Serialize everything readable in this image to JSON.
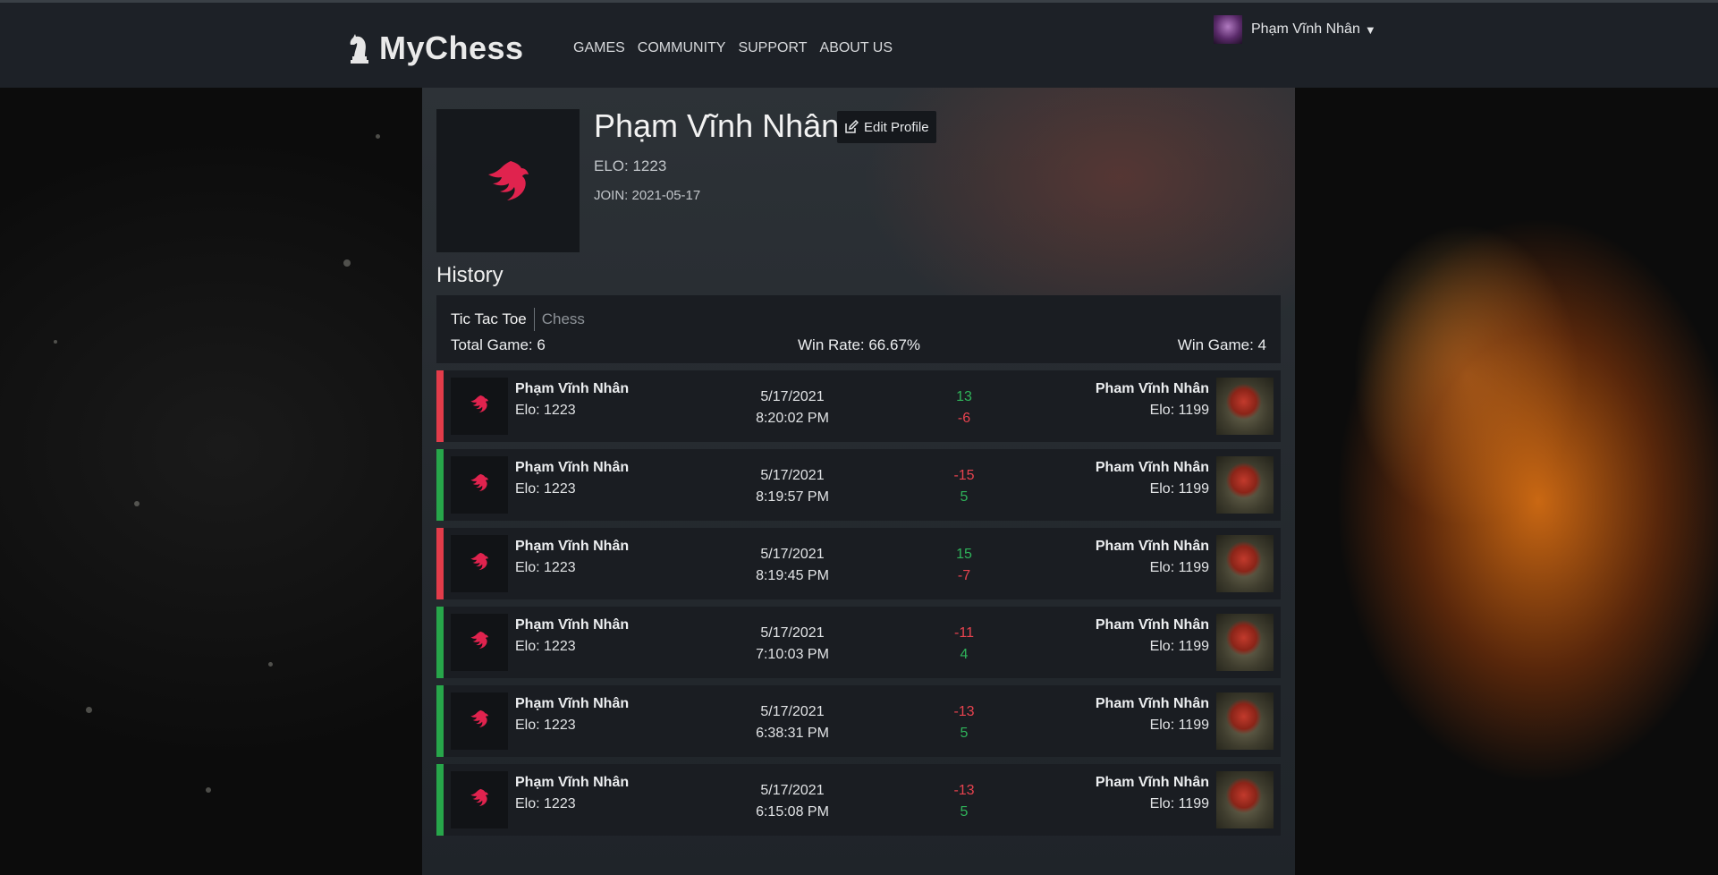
{
  "nav": {
    "brand": "MyChess",
    "links": [
      "GAMES",
      "COMMUNITY",
      "SUPPORT",
      "ABOUT US"
    ],
    "user_name": "Phạm Vĩnh Nhân"
  },
  "profile": {
    "name": "Phạm Vĩnh Nhân",
    "edit_label": "Edit Profile",
    "elo": "ELO: 1223",
    "join": "JOIN: 2021-05-17"
  },
  "history": {
    "title": "History",
    "tabs": [
      "Tic Tac Toe",
      "Chess"
    ],
    "active_tab": "Tic Tac Toe",
    "total": "Total Game: 6",
    "win_rate": "Win Rate: 66.67%",
    "win_game": "Win Game: 4"
  },
  "colors": {
    "loss_bar": "#e23c4a",
    "win_bar": "#27a64a",
    "positive": "#2fb45a",
    "negative": "#e8434f",
    "accent_logo": "#e0234e"
  },
  "games": [
    {
      "result": "loss",
      "p1_name": "Phạm Vĩnh Nhân",
      "p1_elo": "Elo: 1223",
      "date": "5/17/2021",
      "time": "8:20:02 PM",
      "delta_top": "13",
      "delta_bottom": "-6",
      "p2_name": "Pham Vĩnh Nhân",
      "p2_elo": "Elo: 1199"
    },
    {
      "result": "win",
      "p1_name": "Phạm Vĩnh Nhân",
      "p1_elo": "Elo: 1223",
      "date": "5/17/2021",
      "time": "8:19:57 PM",
      "delta_top": "-15",
      "delta_bottom": "5",
      "p2_name": "Pham Vĩnh Nhân",
      "p2_elo": "Elo: 1199"
    },
    {
      "result": "loss",
      "p1_name": "Phạm Vĩnh Nhân",
      "p1_elo": "Elo: 1223",
      "date": "5/17/2021",
      "time": "8:19:45 PM",
      "delta_top": "15",
      "delta_bottom": "-7",
      "p2_name": "Pham Vĩnh Nhân",
      "p2_elo": "Elo: 1199"
    },
    {
      "result": "win",
      "p1_name": "Phạm Vĩnh Nhân",
      "p1_elo": "Elo: 1223",
      "date": "5/17/2021",
      "time": "7:10:03 PM",
      "delta_top": "-11",
      "delta_bottom": "4",
      "p2_name": "Pham Vĩnh Nhân",
      "p2_elo": "Elo: 1199"
    },
    {
      "result": "win",
      "p1_name": "Phạm Vĩnh Nhân",
      "p1_elo": "Elo: 1223",
      "date": "5/17/2021",
      "time": "6:38:31 PM",
      "delta_top": "-13",
      "delta_bottom": "5",
      "p2_name": "Pham Vĩnh Nhân",
      "p2_elo": "Elo: 1199"
    },
    {
      "result": "win",
      "p1_name": "Phạm Vĩnh Nhân",
      "p1_elo": "Elo: 1223",
      "date": "5/17/2021",
      "time": "6:15:08 PM",
      "delta_top": "-13",
      "delta_bottom": "5",
      "p2_name": "Pham Vĩnh Nhân",
      "p2_elo": "Elo: 1199"
    }
  ]
}
